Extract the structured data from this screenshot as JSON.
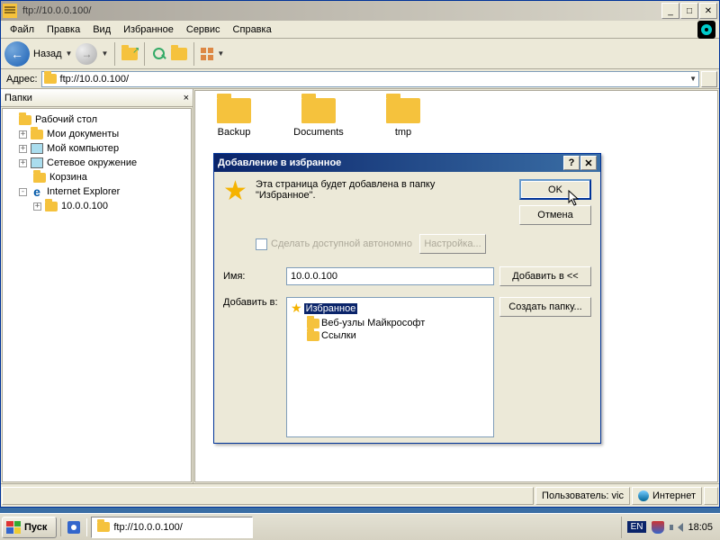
{
  "window": {
    "title": "ftp://10.0.0.100/"
  },
  "menu": {
    "file": "Файл",
    "edit": "Правка",
    "view": "Вид",
    "favorites": "Избранное",
    "tools": "Сервис",
    "help": "Справка"
  },
  "toolbar": {
    "back": "Назад"
  },
  "address": {
    "label": "Адрес:",
    "value": "ftp://10.0.0.100/"
  },
  "sidebar": {
    "title": "Папки",
    "items": [
      {
        "label": "Рабочий стол",
        "indent": 0,
        "twisty": ""
      },
      {
        "label": "Мои документы",
        "indent": 1,
        "twisty": "+"
      },
      {
        "label": "Мой компьютер",
        "indent": 1,
        "twisty": "+"
      },
      {
        "label": "Сетевое окружение",
        "indent": 1,
        "twisty": "+"
      },
      {
        "label": "Корзина",
        "indent": 1,
        "twisty": ""
      },
      {
        "label": "Internet Explorer",
        "indent": 1,
        "twisty": "-"
      },
      {
        "label": "10.0.0.100",
        "indent": 2,
        "twisty": "+"
      }
    ]
  },
  "files": [
    {
      "name": "Backup"
    },
    {
      "name": "Documents"
    },
    {
      "name": "tmp"
    }
  ],
  "status": {
    "user": "Пользователь: vic",
    "zone": "Интернет"
  },
  "dialog": {
    "title": "Добавление в избранное",
    "text1": "Эта страница будет добавлена в папку",
    "text2": "\"Избранное\".",
    "ok": "OK",
    "cancel": "Отмена",
    "offline_label": "Сделать доступной автономно",
    "settings": "Настройка...",
    "name_label": "Имя:",
    "name_value": "10.0.0.100",
    "addto_label": "Добавить в:",
    "addto_btn": "Добавить в <<",
    "newfolder": "Создать папку...",
    "tree": [
      {
        "label": "Избранное",
        "indent": 0,
        "selected": true
      },
      {
        "label": "Веб-узлы Майкрософт",
        "indent": 1,
        "selected": false
      },
      {
        "label": "Ссылки",
        "indent": 1,
        "selected": false
      }
    ]
  },
  "taskbar": {
    "start": "Пуск",
    "task": "ftp://10.0.0.100/",
    "lang": "EN",
    "time": "18:05"
  }
}
